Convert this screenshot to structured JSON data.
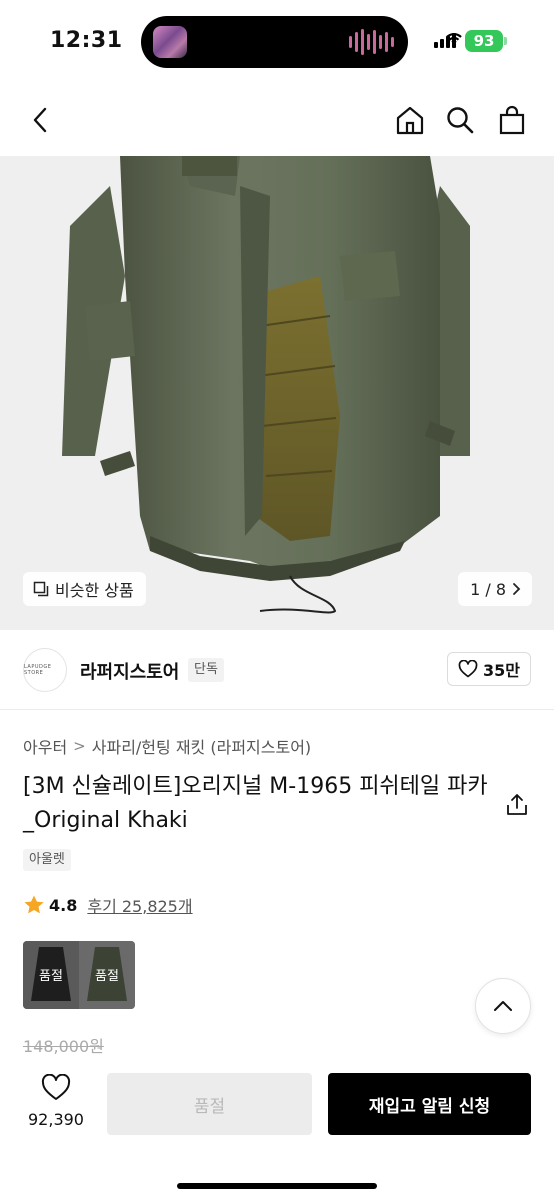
{
  "status_bar": {
    "time": "12:31",
    "battery": "93"
  },
  "nav": {
    "back_icon": "chevron-left-icon",
    "home_icon": "home-icon",
    "search_icon": "search-icon",
    "bag_icon": "shopping-bag-icon"
  },
  "hero": {
    "similar_label": "비슷한 상품",
    "counter": "1 / 8"
  },
  "store": {
    "logo_text": "LAPUDGE STORE",
    "name": "라퍼지스토어",
    "badge": "단독",
    "likes": "35만"
  },
  "breadcrumb": [
    "아우터",
    "사파리/헌팅 재킷 (라퍼지스토어)"
  ],
  "product": {
    "title": "[3M 신슐레이트]오리지널 M-1965 피쉬테일 파카_Original Khaki",
    "tag": "아울렛",
    "rating": "4.8",
    "review_text": "후기 25,825개",
    "options": [
      {
        "label": "품절"
      },
      {
        "label": "품절"
      }
    ],
    "original_price": "148,000원"
  },
  "bottom": {
    "wish_count": "92,390",
    "soldout_label": "품절",
    "restock_label": "재입고 알림 신청"
  },
  "colors": {
    "accent": "#000000",
    "star": "#f5a623",
    "battery": "#34c759"
  }
}
